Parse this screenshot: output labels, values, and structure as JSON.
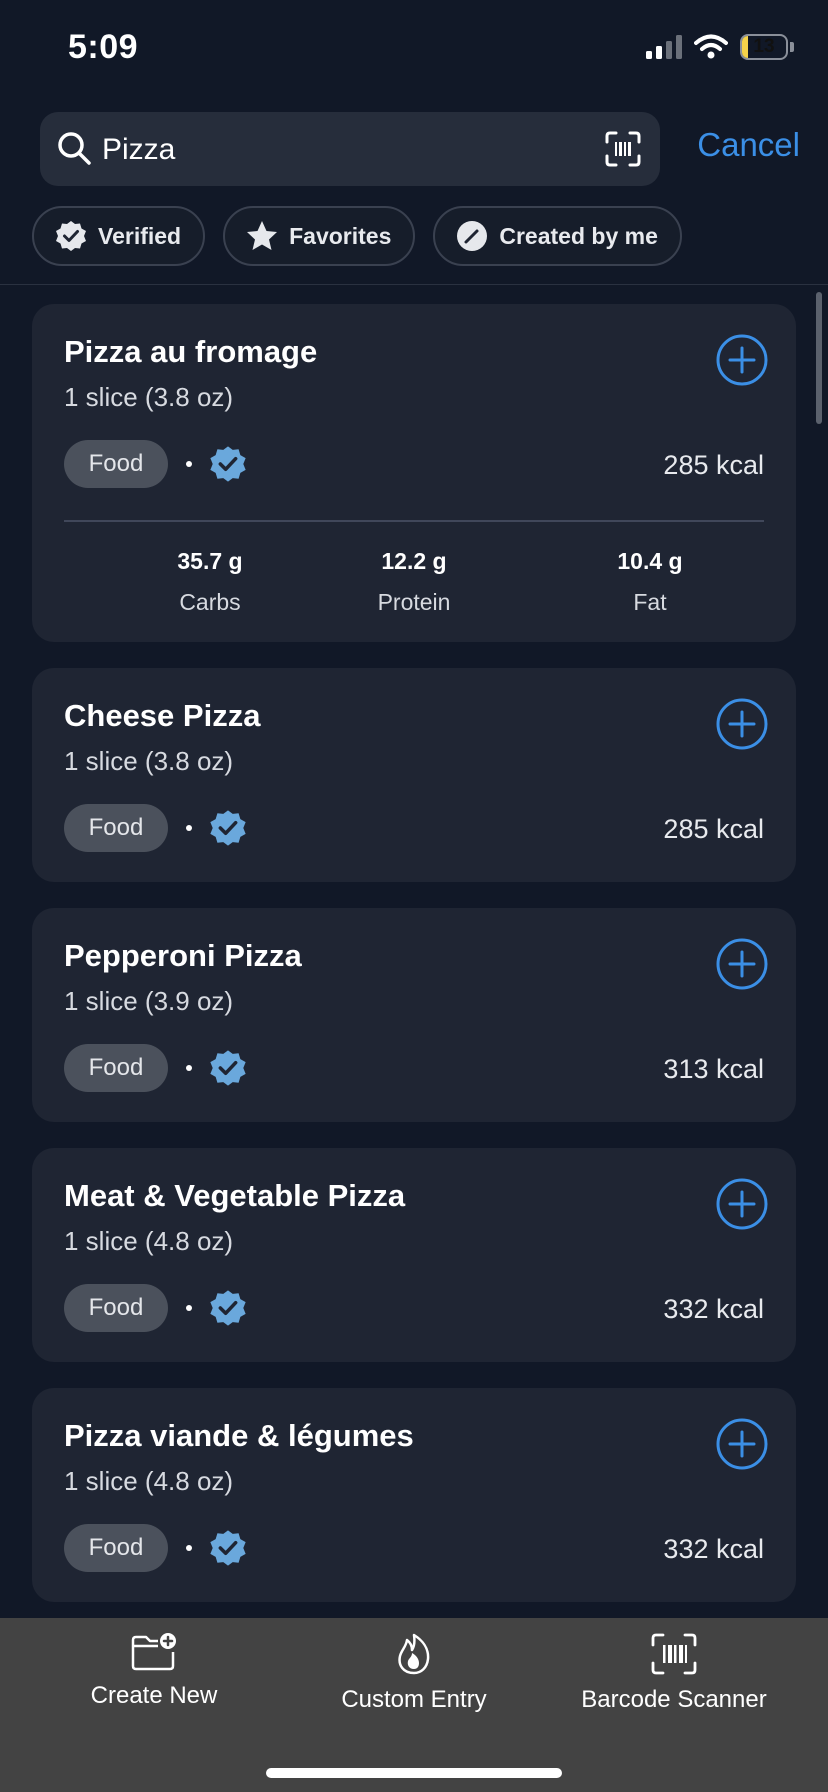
{
  "status": {
    "time": "5:09",
    "battery": "13",
    "battery_level": 0.13
  },
  "search": {
    "query": "Pizza",
    "cancel": "Cancel"
  },
  "filters": [
    {
      "label": "Verified",
      "icon": "verified-badge-icon"
    },
    {
      "label": "Favorites",
      "icon": "star-icon"
    },
    {
      "label": "Created by me",
      "icon": "pencil-icon"
    }
  ],
  "results": [
    {
      "name": "Pizza au fromage",
      "serving": "1 slice (3.8 oz)",
      "tag": "Food",
      "kcal": "285 kcal",
      "macros": [
        {
          "value": "35.7 g",
          "label": "Carbs"
        },
        {
          "value": "12.2 g",
          "label": "Protein"
        },
        {
          "value": "10.4 g",
          "label": "Fat"
        }
      ]
    },
    {
      "name": "Cheese Pizza",
      "serving": "1 slice (3.8 oz)",
      "tag": "Food",
      "kcal": "285 kcal"
    },
    {
      "name": "Pepperoni Pizza",
      "serving": "1 slice (3.9 oz)",
      "tag": "Food",
      "kcal": "313 kcal"
    },
    {
      "name": "Meat & Vegetable Pizza",
      "serving": "1 slice (4.8 oz)",
      "tag": "Food",
      "kcal": "332 kcal"
    },
    {
      "name": "Pizza viande & légumes",
      "serving": "1 slice (4.8 oz)",
      "tag": "Food",
      "kcal": "332 kcal"
    }
  ],
  "bottom_bar": [
    {
      "label": "Create New",
      "icon": "folder-plus-icon"
    },
    {
      "label": "Custom Entry",
      "icon": "flame-icon"
    },
    {
      "label": "Barcode Scanner",
      "icon": "barcode-scan-icon"
    }
  ],
  "colors": {
    "accent": "#3b8fe6",
    "verified": "#6aa8dc",
    "card": "#1f2533",
    "background": "#111827"
  }
}
